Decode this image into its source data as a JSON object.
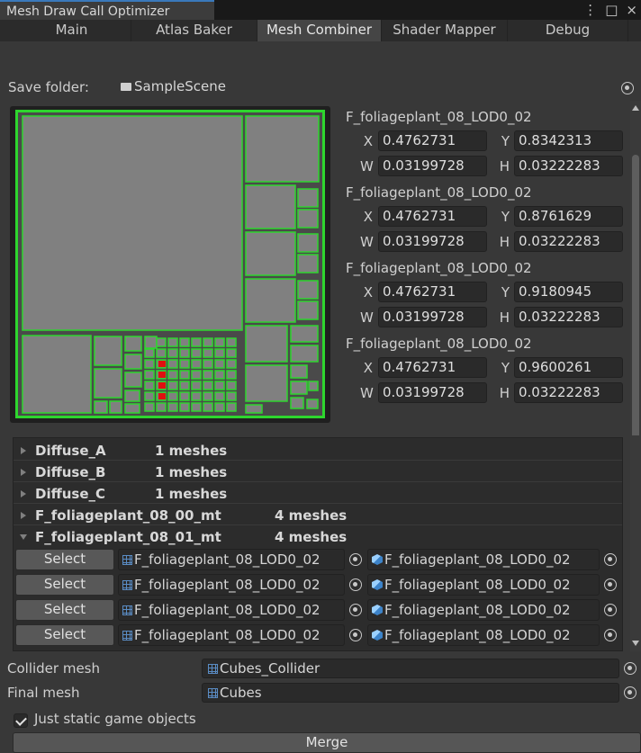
{
  "window": {
    "title": "Mesh Draw Call Optimizer",
    "kebab_label": "⋮",
    "maximize_label": "□",
    "close_label": "×"
  },
  "tabs": [
    {
      "label": "Main",
      "active": false
    },
    {
      "label": "Atlas Baker",
      "active": false
    },
    {
      "label": "Mesh Combiner",
      "active": true
    },
    {
      "label": "Shader Mapper",
      "active": false
    },
    {
      "label": "Debug",
      "active": false
    }
  ],
  "save_folder": {
    "label": "Save folder:",
    "value": "SampleScene"
  },
  "uv_entries": [
    {
      "name": "F_foliageplant_08_LOD0_02",
      "x": "0.4762731",
      "y": "0.8342313",
      "w": "0.03199728",
      "h": "0.03222283"
    },
    {
      "name": "F_foliageplant_08_LOD0_02",
      "x": "0.4762731",
      "y": "0.8761629",
      "w": "0.03199728",
      "h": "0.03222283"
    },
    {
      "name": "F_foliageplant_08_LOD0_02",
      "x": "0.4762731",
      "y": "0.9180945",
      "w": "0.03199728",
      "h": "0.03222283"
    },
    {
      "name": "F_foliageplant_08_LOD0_02",
      "x": "0.4762731",
      "y": "0.9600261",
      "w": "0.03199728",
      "h": "0.03222283"
    }
  ],
  "uv_keys": {
    "x": "X",
    "y": "Y",
    "w": "W",
    "h": "H"
  },
  "material_groups": [
    {
      "name": "Diffuse_A",
      "count": "1 meshes",
      "expanded": false
    },
    {
      "name": "Diffuse_B",
      "count": "1 meshes",
      "expanded": false
    },
    {
      "name": "Diffuse_C",
      "count": "1 meshes",
      "expanded": false
    },
    {
      "name": "F_foliageplant_08_00_mt",
      "count": "4 meshes",
      "expanded": false
    },
    {
      "name": "F_foliageplant_08_01_mt",
      "count": "4 meshes",
      "expanded": true
    }
  ],
  "mesh_rows": [
    {
      "select_label": "Select",
      "mesh": "F_foliageplant_08_LOD0_02",
      "object": "F_foliageplant_08_LOD0_02"
    },
    {
      "select_label": "Select",
      "mesh": "F_foliageplant_08_LOD0_02",
      "object": "F_foliageplant_08_LOD0_02"
    },
    {
      "select_label": "Select",
      "mesh": "F_foliageplant_08_LOD0_02",
      "object": "F_foliageplant_08_LOD0_02"
    },
    {
      "select_label": "Select",
      "mesh": "F_foliageplant_08_LOD0_02",
      "object": "F_foliageplant_08_LOD0_02"
    }
  ],
  "collider_mesh": {
    "label": "Collider mesh",
    "value": "Cubes_Collider"
  },
  "final_mesh": {
    "label": "Final mesh",
    "value": "Cubes"
  },
  "static_only": {
    "label": "Just static game objects",
    "checked": true
  },
  "merge_label": "Merge",
  "colors": {
    "atlas_outline": "#2ed62e",
    "atlas_fill": "#808080",
    "atlas_selected": "#e01010",
    "accent": "#3a79bb"
  }
}
